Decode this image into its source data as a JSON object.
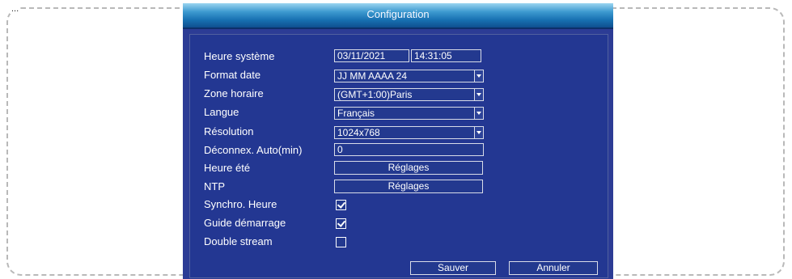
{
  "corner_text": "...",
  "dialog": {
    "title": "Configuration",
    "rows": [
      {
        "label": "Heure système",
        "type": "datetime",
        "date": "03/11/2021",
        "time": "14:31:05"
      },
      {
        "label": "Format date",
        "type": "select",
        "value": "JJ MM AAAA 24"
      },
      {
        "label": "Zone horaire",
        "type": "select",
        "value": "(GMT+1:00)Paris"
      },
      {
        "label": "Langue",
        "type": "select",
        "value": "Français"
      },
      {
        "label": "Résolution",
        "type": "select",
        "value": "1024x768"
      },
      {
        "label": "Déconnex. Auto(min)",
        "type": "text",
        "value": "0"
      },
      {
        "label": "Heure été",
        "type": "button",
        "value": "Réglages"
      },
      {
        "label": "NTP",
        "type": "button",
        "value": "Réglages"
      },
      {
        "label": "Synchro. Heure",
        "type": "checkbox",
        "checked": true
      },
      {
        "label": "Guide démarrage",
        "type": "checkbox",
        "checked": true
      },
      {
        "label": "Double stream",
        "type": "checkbox",
        "checked": false
      }
    ],
    "buttons": {
      "save": "Sauver",
      "cancel": "Annuler"
    }
  }
}
